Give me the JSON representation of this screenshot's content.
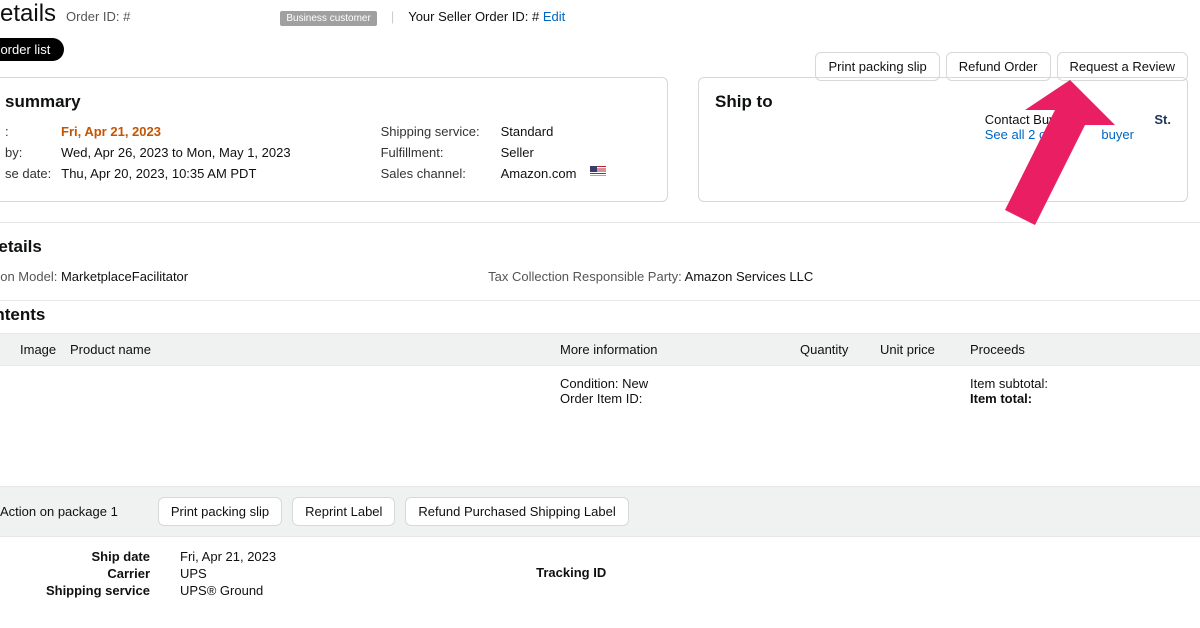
{
  "header": {
    "page_title_fragment": "r details",
    "order_id_label": "Order ID: #",
    "badge": "Business customer",
    "seller_order_label": "Your Seller Order ID: #",
    "edit_link": "Edit",
    "back_button": "to order list"
  },
  "top_actions": {
    "print": "Print packing slip",
    "refund": "Refund Order",
    "request_review": "Request a Review"
  },
  "summary": {
    "title_fragment": "summary",
    "left": [
      {
        "k": ":",
        "v": "Fri, Apr 21, 2023",
        "orange": true
      },
      {
        "k": "by:",
        "v": "Wed, Apr 26, 2023 to Mon, May 1, 2023"
      },
      {
        "k": "se date:",
        "v": "Thu, Apr 20, 2023, 10:35 AM PDT"
      }
    ],
    "right": [
      {
        "k": "Shipping service:",
        "v": "Standard"
      },
      {
        "k": "Fulfillment:",
        "v": "Seller"
      },
      {
        "k": "Sales channel:",
        "v": "Amazon.com",
        "flag": true
      }
    ]
  },
  "ship_to": {
    "title": "Ship to",
    "contact_buyer_label": "Contact Buyer:",
    "see_orders_link": "See all 2 ord",
    "buyer_fragment": "buyer",
    "st": "St."
  },
  "tax": {
    "title_fragment": "details",
    "model_label": "ection Model:",
    "model_value": "MarketplaceFacilitator",
    "party_label": "Tax Collection Responsible Party:",
    "party_value": "Amazon Services LLC"
  },
  "contents": {
    "title_fragment": "ontents",
    "headers": {
      "image": "Image",
      "product": "Product name",
      "more": "More information",
      "qty": "Quantity",
      "unit": "Unit price",
      "proceeds": "Proceeds"
    },
    "row": {
      "condition_label": "Condition:",
      "condition_value": "New",
      "order_item_label": "Order Item ID:",
      "subtotal_label": "Item subtotal:",
      "total_label": "Item total:"
    }
  },
  "package": {
    "title_fragment": "1",
    "action_label": "Action on package 1",
    "print_btn": "Print packing slip",
    "reprint_btn": "Reprint Label",
    "refund_label_btn": "Refund Purchased Shipping Label",
    "ship_date_label": "Ship date",
    "carrier_label": "Carrier",
    "service_label": "Shipping service",
    "ship_date": "Fri, Apr 21, 2023",
    "carrier": "UPS",
    "service": "UPS® Ground",
    "tracking_label": "Tracking ID"
  }
}
